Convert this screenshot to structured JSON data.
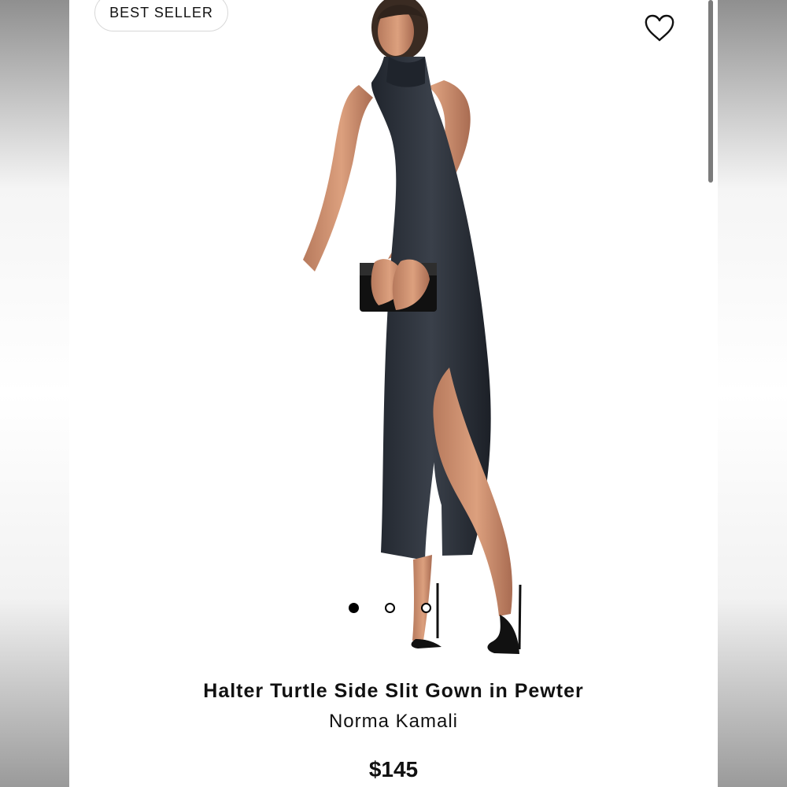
{
  "badge": {
    "label": "BEST SELLER"
  },
  "product": {
    "title": "Halter Turtle Side Slit Gown in Pewter",
    "brand": "Norma Kamali",
    "price": "$145"
  },
  "gallery": {
    "current_index": 1,
    "total_images": 3
  },
  "icons": {
    "favorite": "heart-icon"
  },
  "colors": {
    "dress": "#2b3038",
    "text": "#111111",
    "badge_border": "#d8d8d8",
    "scrollbar": "#7b7b7b"
  }
}
